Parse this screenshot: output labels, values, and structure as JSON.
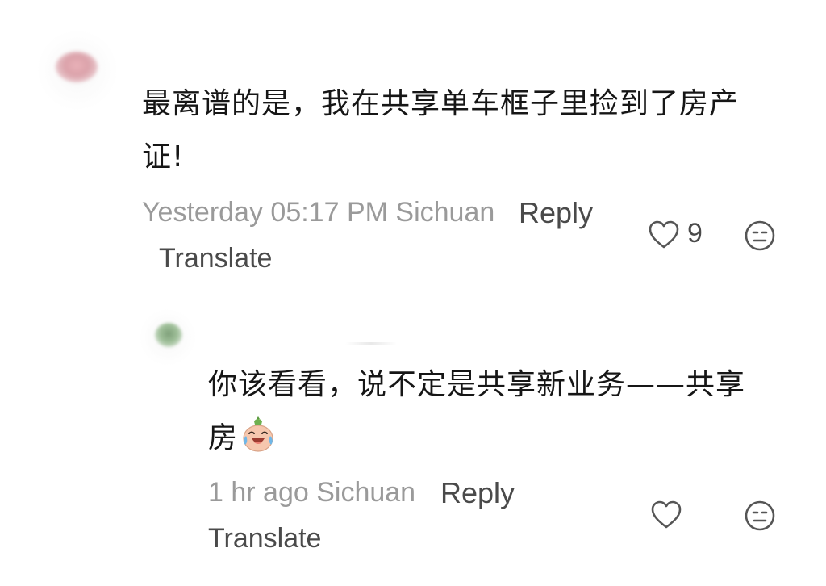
{
  "comments": [
    {
      "text_line1": "最离谱的是，我在共享单车框子里捡到了房产",
      "text_line2": "证!",
      "time": "Yesterday 05:17 PM",
      "location": "Sichuan",
      "reply_label": "Reply",
      "translate_label": "Translate",
      "likes": "9",
      "icons": {
        "avatar": "avatar-blurred",
        "like": "heart-outline-icon",
        "dislike": "neutral-face-icon"
      }
    },
    {
      "text_line1": "你该看看，说不定是共享新业务——共享",
      "text_line2": "房",
      "emoji": "laughing-crying-emoji",
      "time": "1 hr ago",
      "location": "Sichuan",
      "reply_label": "Reply",
      "translate_label": "Translate",
      "icons": {
        "avatar": "avatar-blurred",
        "like": "heart-outline-icon",
        "dislike": "neutral-face-icon"
      }
    }
  ],
  "colors": {
    "text": "#161616",
    "meta": "#9a9a9a",
    "action": "#4a4a4a",
    "icon": "#555555"
  }
}
